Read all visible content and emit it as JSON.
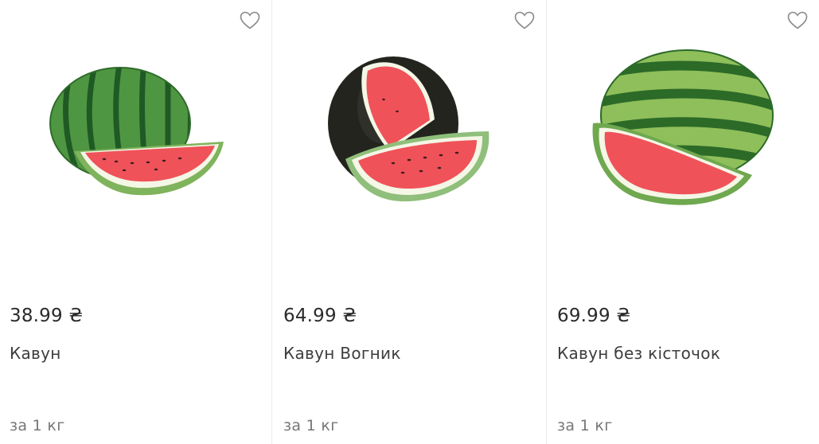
{
  "products": [
    {
      "price": "38.99 ₴",
      "name": "Кавун",
      "unit": "за 1 кг",
      "image": "watermelon-round-striped-slice",
      "favorite_icon": "heart-outline-icon"
    },
    {
      "price": "64.99 ₴",
      "name": "Кавун Вогник",
      "unit": "за 1 кг",
      "image": "watermelon-dark-cut-slice",
      "favorite_icon": "heart-outline-icon"
    },
    {
      "price": "69.99 ₴",
      "name": "Кавун без кісточок",
      "unit": "за 1 кг",
      "image": "watermelon-oval-striped-slice",
      "favorite_icon": "heart-outline-icon"
    }
  ],
  "colors": {
    "rind_green": "#3f8a3a",
    "rind_dark": "#24241f",
    "flesh_red": "#f0525a",
    "heart_stroke": "#8a8a8a"
  }
}
